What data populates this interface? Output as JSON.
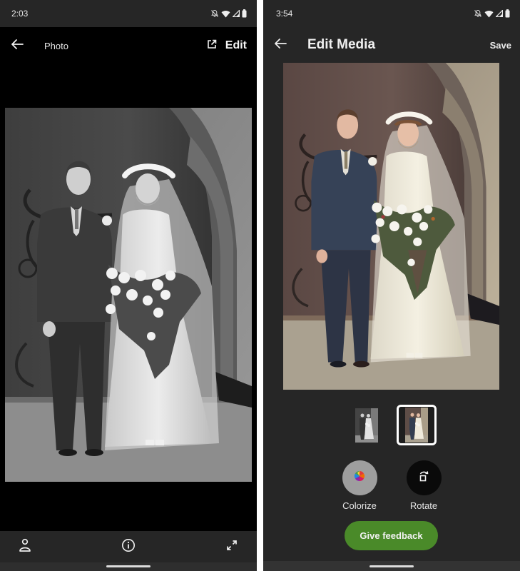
{
  "left_screen": {
    "status_bar": {
      "time": "2:03",
      "icons": [
        "notifications-off-icon",
        "wifi-icon",
        "signal-icon",
        "battery-icon"
      ]
    },
    "app_bar": {
      "back_icon": "arrow-left-icon",
      "title": "Photo",
      "open_external_icon": "open-in-new-icon",
      "edit_label": "Edit"
    },
    "photo": {
      "description": "Black-and-white wedding photo of a groom in a double-breasted suit and a bride in a white gown and veil holding a cascading bouquet, standing before an arched church door",
      "style": "grayscale"
    },
    "bottom_bar": {
      "icons": [
        "person-icon",
        "info-icon",
        "fullscreen-icon"
      ]
    }
  },
  "right_screen": {
    "status_bar": {
      "time": "3:54",
      "icons": [
        "notifications-off-icon",
        "wifi-icon",
        "signal-icon",
        "battery-icon"
      ]
    },
    "app_bar": {
      "back_icon": "arrow-left-icon",
      "title": "Edit Media",
      "save_label": "Save"
    },
    "photo": {
      "description": "Colorized version of the wedding photo",
      "style": "colorized"
    },
    "thumbnails": [
      {
        "name": "original",
        "selected": false
      },
      {
        "name": "colorized",
        "selected": true
      }
    ],
    "tools": [
      {
        "name": "colorize",
        "label": "Colorize",
        "icon": "color-palette-icon",
        "active": true
      },
      {
        "name": "rotate",
        "label": "Rotate",
        "icon": "rotate-icon",
        "active": false
      }
    ],
    "feedback_button": {
      "label": "Give feedback",
      "color": "#4a8a29"
    }
  }
}
